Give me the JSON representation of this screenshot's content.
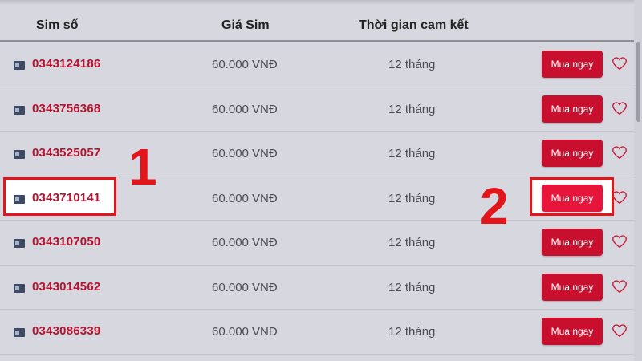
{
  "header": {
    "sim_col": "Sim số",
    "price_col": "Giá Sim",
    "term_col": "Thời gian cam kết"
  },
  "rows": [
    {
      "number": "0343124186",
      "price": "60.000 VNĐ",
      "term": "12 tháng",
      "buy_label": "Mua ngay"
    },
    {
      "number": "0343756368",
      "price": "60.000 VNĐ",
      "term": "12 tháng",
      "buy_label": "Mua ngay"
    },
    {
      "number": "0343525057",
      "price": "60.000 VNĐ",
      "term": "12 tháng",
      "buy_label": "Mua ngay"
    },
    {
      "number": "0343710141",
      "price": "60.000 VNĐ",
      "term": "12 tháng",
      "buy_label": "Mua ngay"
    },
    {
      "number": "0343107050",
      "price": "60.000 VNĐ",
      "term": "12 tháng",
      "buy_label": "Mua ngay"
    },
    {
      "number": "0343014562",
      "price": "60.000 VNĐ",
      "term": "12 tháng",
      "buy_label": "Mua ngay"
    },
    {
      "number": "0343086339",
      "price": "60.000 VNĐ",
      "term": "12 tháng",
      "buy_label": "Mua ngay"
    }
  ],
  "annotations": {
    "step1": "1",
    "step2": "2"
  },
  "colors": {
    "accent": "#c8102e",
    "annotation": "#e3141a",
    "background": "#d7d7df"
  },
  "icons": {
    "sim": "sim-card-icon",
    "favorite": "heart-icon"
  }
}
